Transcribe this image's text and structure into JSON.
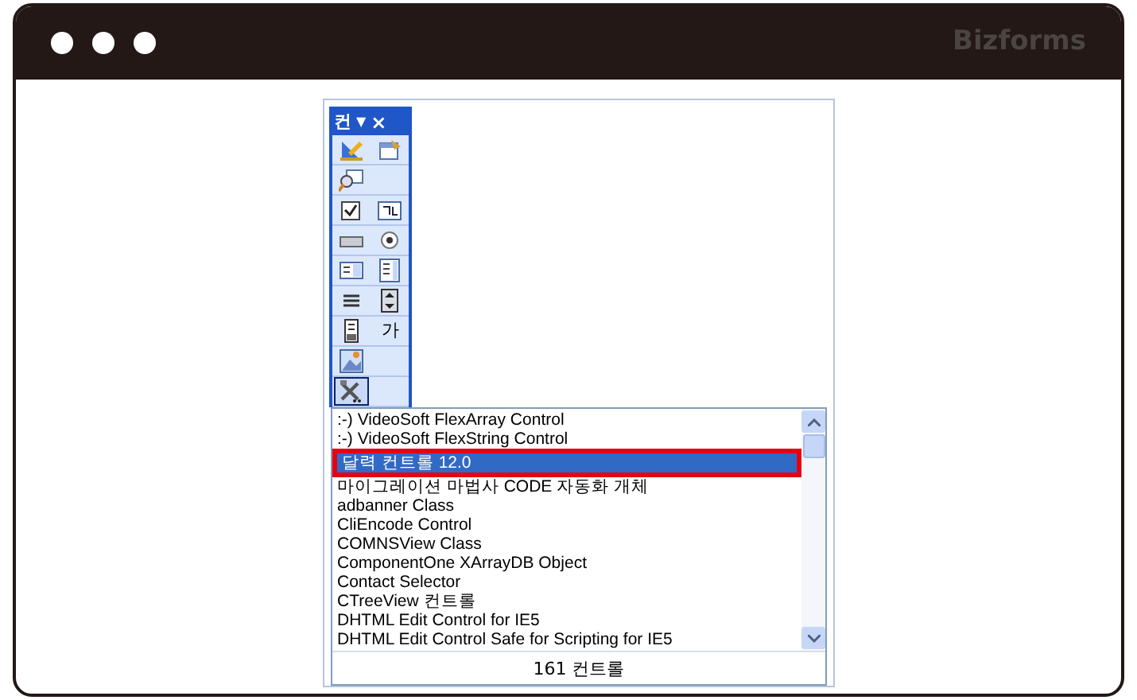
{
  "window": {
    "brand": "Bizforms"
  },
  "toolbox": {
    "title": "컨",
    "menu_glyph": "▼",
    "close_glyph": "×",
    "rows": [
      [
        {
          "kind": "pencil",
          "selected": false
        },
        {
          "kind": "form",
          "selected": false
        }
      ],
      [
        {
          "kind": "magnifier",
          "selected": false
        }
      ],
      [
        {
          "kind": "checkbox",
          "selected": false
        },
        {
          "kind": "frame",
          "selected": false
        }
      ],
      [
        {
          "kind": "button",
          "selected": false
        },
        {
          "kind": "radio",
          "selected": false
        }
      ],
      [
        {
          "kind": "combo",
          "selected": false
        },
        {
          "kind": "listbox",
          "selected": false
        }
      ],
      [
        {
          "kind": "scrollbar",
          "selected": false
        },
        {
          "kind": "spinner",
          "selected": false
        }
      ],
      [
        {
          "kind": "tabstrip",
          "selected": false
        },
        {
          "kind": "label",
          "label": "가",
          "selected": false
        }
      ],
      [
        {
          "kind": "image",
          "selected": false
        }
      ],
      [
        {
          "kind": "tools",
          "selected": true
        }
      ]
    ]
  },
  "control_list": {
    "items": [
      {
        "label": ":-) VideoSoft FlexArray Control",
        "selected": false
      },
      {
        "label": ":-) VideoSoft FlexString Control",
        "selected": false
      },
      {
        "label": "달력 컨트롤 12.0",
        "selected": true
      },
      {
        "label": "마이그레이션 마법사 CODE 자동화 개체",
        "selected": false
      },
      {
        "label": "adbanner Class",
        "selected": false
      },
      {
        "label": "CliEncode Control",
        "selected": false
      },
      {
        "label": "COMNSView Class",
        "selected": false
      },
      {
        "label": "ComponentOne XArrayDB Object",
        "selected": false
      },
      {
        "label": "Contact Selector",
        "selected": false
      },
      {
        "label": "CTreeView 컨트롤",
        "selected": false
      },
      {
        "label": "DHTML Edit Control for IE5",
        "selected": false
      },
      {
        "label": "DHTML Edit Control Safe for Scripting for IE5",
        "selected": false
      }
    ],
    "highlighted": true,
    "status": "161 컨트롤"
  }
}
